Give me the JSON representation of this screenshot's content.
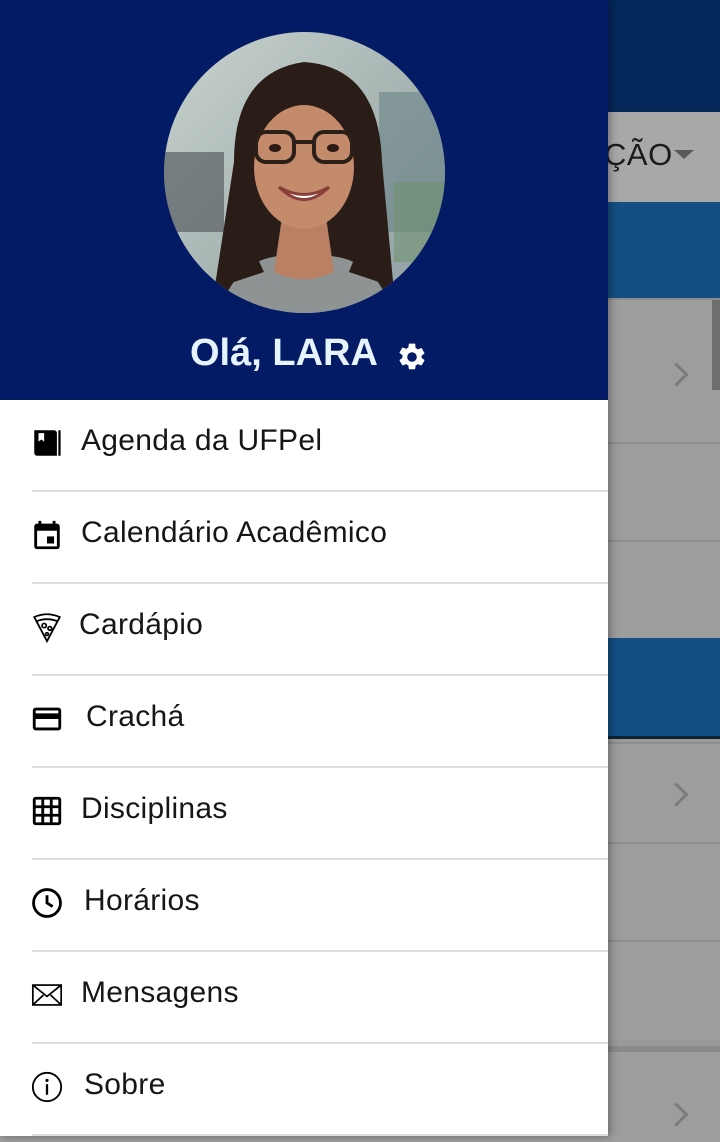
{
  "background": {
    "dropdown_label": "ÇÃO"
  },
  "drawer": {
    "greeting": "Olá, LARA",
    "menu": [
      {
        "label": "Agenda da UFPel",
        "icon": "book-icon"
      },
      {
        "label": "Calendário Acadêmico",
        "icon": "calendar-icon"
      },
      {
        "label": "Cardápio",
        "icon": "pizza-icon"
      },
      {
        "label": "Crachá",
        "icon": "credit-card-icon"
      },
      {
        "label": "Disciplinas",
        "icon": "grid-icon"
      },
      {
        "label": "Horários",
        "icon": "clock-icon"
      },
      {
        "label": "Mensagens",
        "icon": "envelope-icon"
      },
      {
        "label": "Sobre",
        "icon": "info-icon"
      }
    ]
  },
  "colors": {
    "header": "#031a64",
    "greeting": "#e6f4ff",
    "band": "#134f83"
  }
}
